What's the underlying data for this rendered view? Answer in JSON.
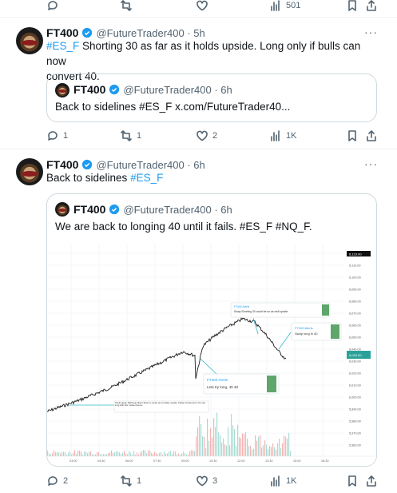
{
  "top_actions": {
    "views": "501"
  },
  "tweet1": {
    "name": "FT400",
    "handle": "@FutureTrader400",
    "time": "5h",
    "hashtag": "#ES_F",
    "text_line1": "Shorting 30 as far as it holds upside.  Long only if bulls can now",
    "text_line2": "convert 40.",
    "quote": {
      "name": "FT400",
      "handle": "@FutureTrader400",
      "time": "6h",
      "text_prefix": "Back to sidelines ",
      "hashtag": "#ES_F",
      "link": " x.com/FutureTrader40..."
    },
    "replies": "1",
    "reposts": "1",
    "likes": "2",
    "views": "1K"
  },
  "tweet2": {
    "name": "FT400",
    "handle": "@FutureTrader400",
    "time": "6h",
    "text_prefix": "Back to sidelines  ",
    "hashtag": "#ES_F",
    "quote": {
      "name": "FT400",
      "handle": "@FutureTrader400",
      "time": "6h",
      "text": "We are back to longing 40 until it fails. #ES_F #NQ_F."
    },
    "replies": "2",
    "reposts": "1",
    "likes": "3",
    "views": "1K"
  },
  "chart": {
    "alert1_title": "FT400 Alerts",
    "alert1_text": "Lets try long, 40 40",
    "alert2_title": "FT400 Alerts",
    "alert2_text": "Swap long in 40",
    "alert3_title": "FT400 Alerts",
    "alert3_text": "Swap Shorting 30 could be so as well upside",
    "note_text": "Trade ideas: Bull bear filters Short to under as in holder upside. Twitter turnaround. You can long with this market theme.",
    "price_labels": [
      "6,120.00",
      "6,110.00",
      "6,100.00",
      "6,090.00",
      "6,080.00",
      "6,070.00",
      "6,060.00",
      "6,050.00",
      "6,040.00",
      "6,030.00",
      "6,020.00",
      "6,010.00",
      "6,000.00",
      "5,990.00",
      "5,980.00",
      "5,970.00",
      "5,960.00"
    ],
    "current_price": "6,123.00",
    "marker_price": "6,043.00",
    "time_labels": [
      "03:00",
      "04:30",
      "06:00",
      "07:30",
      "09:00",
      "10:30",
      "12:00",
      "13:30",
      "15:00",
      "16:30"
    ]
  },
  "colors": {
    "accent": "#1d9bf0",
    "text_secondary": "#536471",
    "alert_green": "#5ea66a"
  }
}
